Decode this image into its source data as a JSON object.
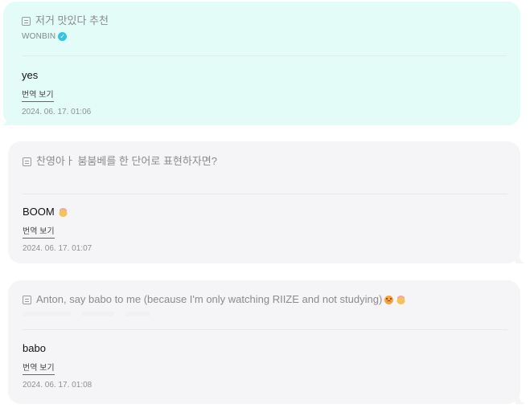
{
  "messages": [
    {
      "question": "저거 맛있다 추천",
      "author": "WONBIN",
      "answer": "yes",
      "translate_label": "번역 보기",
      "timestamp": "2024. 06. 17. 01:06",
      "style": "mint"
    },
    {
      "question": "찬영아ㅏ 붐붐베를 한 단어로 표현하자면?",
      "answer": "BOOM",
      "answer_emoji": "exploding-head-emoji",
      "translate_label": "번역 보기",
      "timestamp": "2024. 06. 17. 01:07",
      "style": "gray"
    },
    {
      "question": "Anton, say babo to me (because I'm only watching RIIZE and not studying)",
      "question_emojis": [
        "pleading-face-emoji",
        "exploding-head-emoji"
      ],
      "answer": "babo",
      "translate_label": "번역 보기",
      "timestamp": "2024. 06. 17. 01:08",
      "style": "gray"
    }
  ],
  "icons": {
    "question": "question-doc-icon",
    "verified": "verified-badge-icon"
  },
  "colors": {
    "mint_bubble": "#e3fcf7",
    "gray_bubble": "#f5f5f7",
    "verified": "#2fc7e0"
  }
}
